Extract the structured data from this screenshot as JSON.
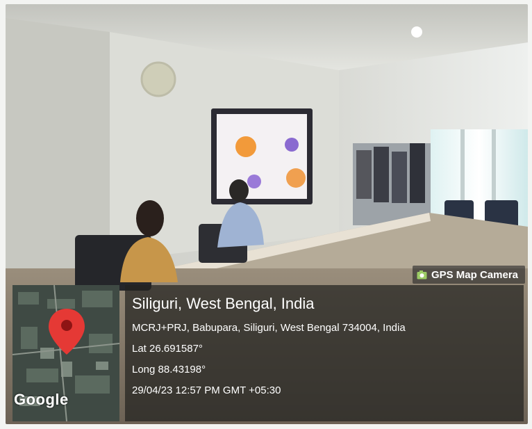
{
  "gps_badge": {
    "label": "GPS Map Camera",
    "icon": "camera-icon"
  },
  "map": {
    "provider_label": "Google",
    "marker_icon": "map-pin-icon",
    "marker_color": "#e53935"
  },
  "location": {
    "title": "Siliguri, West Bengal, India",
    "address": "MCRJ+PRJ, Babupara, Siliguri, West Bengal 734004, India",
    "latitude": "Lat 26.691587°",
    "longitude": "Long 88.43198°",
    "timestamp": "29/04/23 12:57 PM GMT +05:30"
  }
}
